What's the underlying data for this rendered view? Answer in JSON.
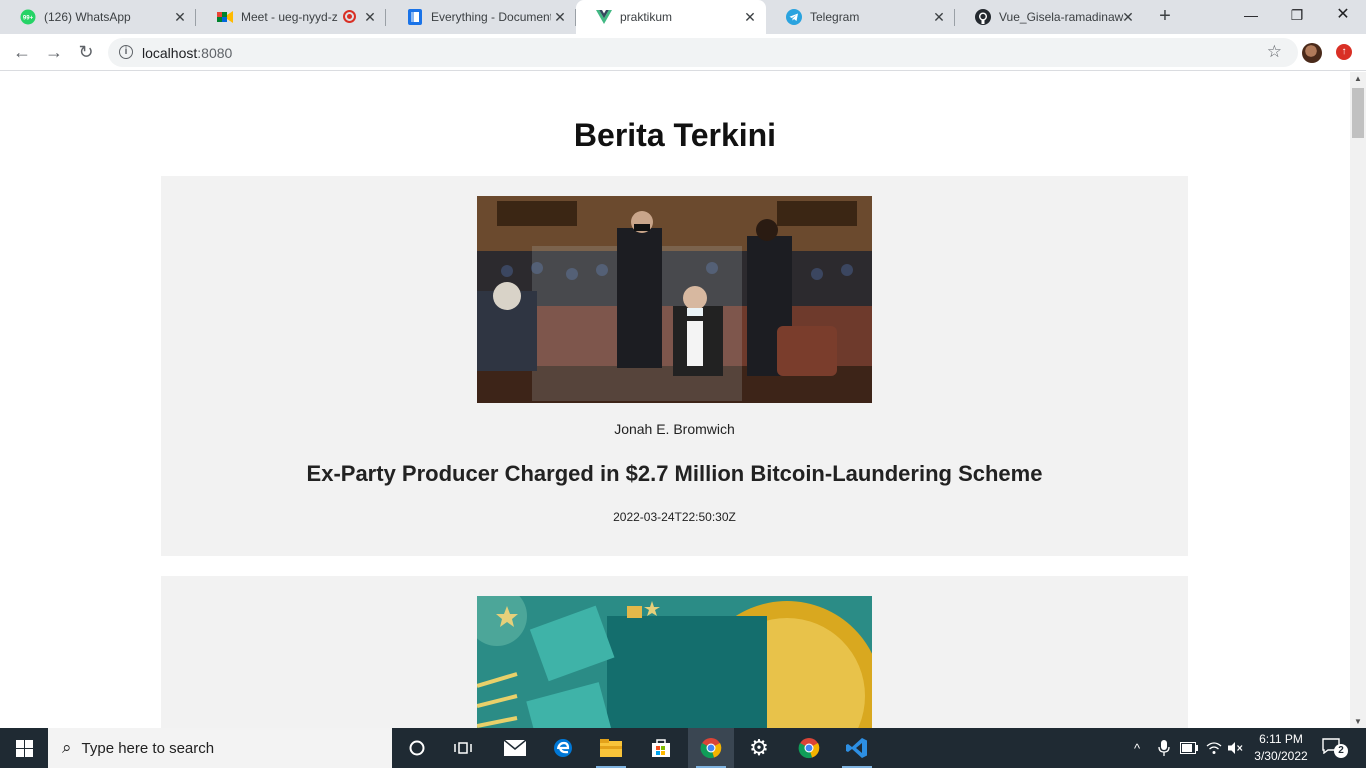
{
  "browser": {
    "tabs": [
      {
        "title": "(126) WhatsApp",
        "icon": "whatsapp-icon",
        "badge": "99+"
      },
      {
        "title": "Meet - ueg-nyyd-z",
        "icon": "google-meet-icon"
      },
      {
        "title": "Everything - Document",
        "icon": "document-icon"
      },
      {
        "title": "praktikum",
        "icon": "vue-icon"
      },
      {
        "title": "Telegram",
        "icon": "telegram-icon"
      },
      {
        "title": "Vue_Gisela-ramadinawa",
        "icon": "github-icon"
      }
    ],
    "active_tab_index": 3,
    "url_host": "localhost",
    "url_port": ":8080"
  },
  "page": {
    "title": "Berita Terkini",
    "articles": [
      {
        "author": "Jonah E. Bromwich",
        "headline": "Ex-Party Producer Charged in $2.7 Million Bitcoin-Laundering Scheme",
        "published_at": "2022-03-24T22:50:30Z"
      },
      {
        "author": "",
        "headline": "",
        "published_at": ""
      }
    ]
  },
  "taskbar": {
    "search_placeholder": "Type here to search",
    "time": "6:11 PM",
    "date": "3/30/2022",
    "notification_count": "2"
  },
  "colors": {
    "tabstrip": "#dee1e6",
    "card_bg": "#f2f2f2",
    "taskbar": "#1f2a33"
  }
}
